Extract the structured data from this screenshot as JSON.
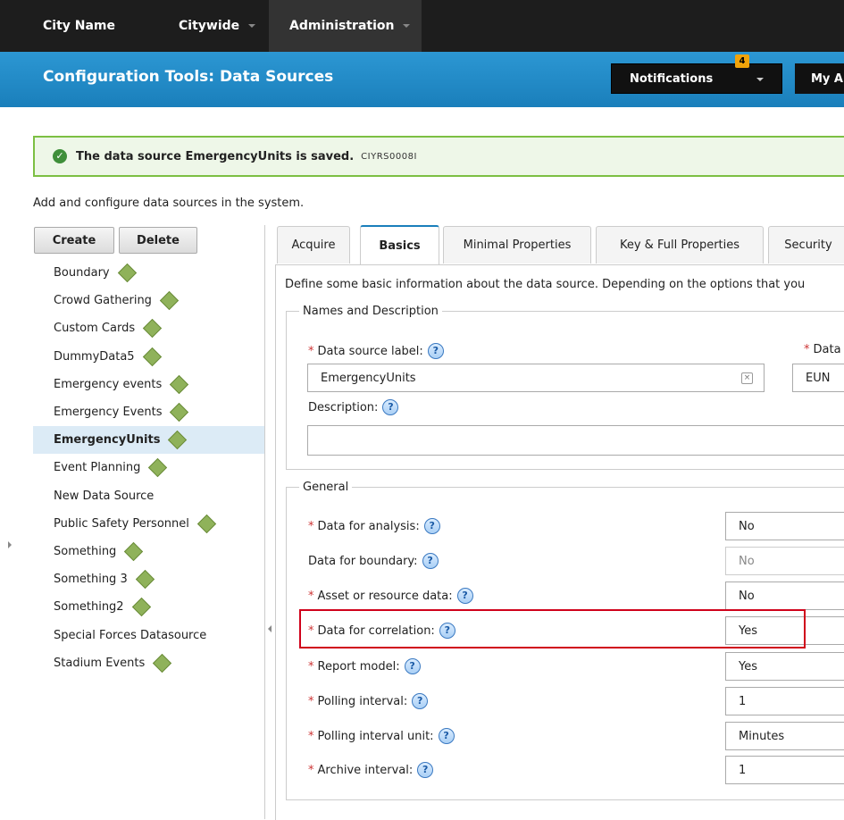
{
  "topbar": {
    "city": "City Name",
    "citywide": "Citywide",
    "admin": "Administration"
  },
  "banner": {
    "title": "Configuration Tools: Data Sources",
    "notifications": "Notifications",
    "notif_count": "4",
    "my_account": "My A"
  },
  "success": {
    "message": "The data source EmergencyUnits is saved.",
    "code": "CIYRS0008I"
  },
  "description": "Add and configure data sources in the system.",
  "buttons": {
    "create": "Create",
    "delete": "Delete"
  },
  "datasources": [
    {
      "label": "Boundary",
      "diamond": true
    },
    {
      "label": "Crowd Gathering",
      "diamond": true
    },
    {
      "label": "Custom Cards",
      "diamond": true
    },
    {
      "label": "DummyData5",
      "diamond": true
    },
    {
      "label": "Emergency events",
      "diamond": true
    },
    {
      "label": "Emergency Events",
      "diamond": true
    },
    {
      "label": "EmergencyUnits",
      "diamond": true,
      "selected": true
    },
    {
      "label": "Event Planning",
      "diamond": true
    },
    {
      "label": "New Data Source",
      "diamond": false
    },
    {
      "label": "Public Safety Personnel",
      "diamond": true
    },
    {
      "label": "Something",
      "diamond": true
    },
    {
      "label": "Something 3",
      "diamond": true
    },
    {
      "label": "Something2",
      "diamond": true
    },
    {
      "label": "Special Forces Datasource",
      "diamond": false
    },
    {
      "label": "Stadium Events",
      "diamond": true
    }
  ],
  "tabs": [
    "Acquire",
    "Basics",
    "Minimal Properties",
    "Key & Full Properties",
    "Security"
  ],
  "active_tab": "Basics",
  "intro": "Define some basic information about the data source. Depending on the options that you",
  "names_group": {
    "legend": "Names and Description",
    "label_field": {
      "label": "Data source label:",
      "value": "EmergencyUnits"
    },
    "id_field": {
      "label": "Data",
      "value": "EUN"
    },
    "description_field": {
      "label": "Description:",
      "value": ""
    }
  },
  "general_group": {
    "legend": "General",
    "rows": [
      {
        "label": "Data for analysis:",
        "required": true,
        "value": "No"
      },
      {
        "label": "Data for boundary:",
        "required": false,
        "value": "No",
        "disabled": true
      },
      {
        "label": "Asset or resource data:",
        "required": true,
        "value": "No"
      },
      {
        "label": "Data for correlation:",
        "required": true,
        "value": "Yes"
      },
      {
        "label": "Report model:",
        "required": true,
        "value": "Yes"
      },
      {
        "label": "Polling interval:",
        "required": true,
        "value": "1"
      },
      {
        "label": "Polling interval unit:",
        "required": true,
        "value": "Minutes"
      },
      {
        "label": "Archive interval:",
        "required": true,
        "value": "1"
      }
    ]
  },
  "help_glyph": "?"
}
